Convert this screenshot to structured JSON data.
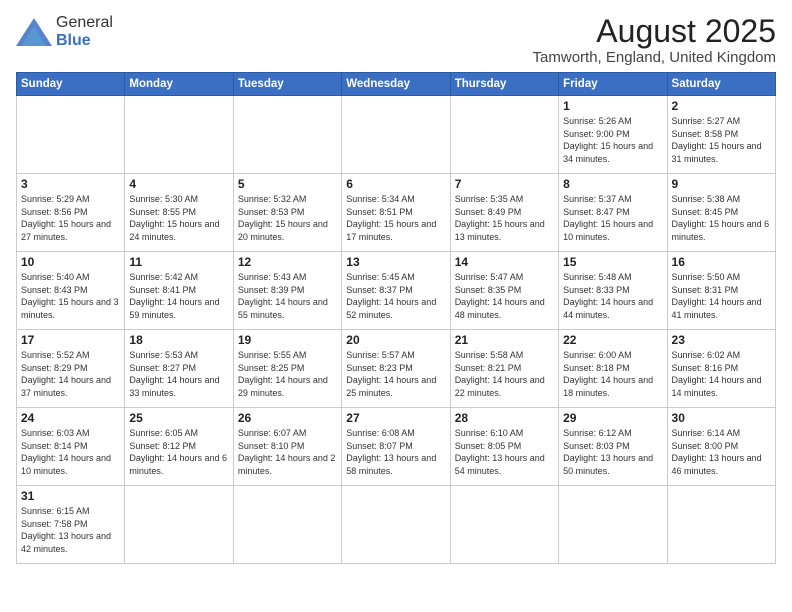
{
  "header": {
    "logo_general": "General",
    "logo_blue": "Blue",
    "title": "August 2025",
    "subtitle": "Tamworth, England, United Kingdom"
  },
  "days_of_week": [
    "Sunday",
    "Monday",
    "Tuesday",
    "Wednesday",
    "Thursday",
    "Friday",
    "Saturday"
  ],
  "weeks": [
    [
      {
        "day": "",
        "info": ""
      },
      {
        "day": "",
        "info": ""
      },
      {
        "day": "",
        "info": ""
      },
      {
        "day": "",
        "info": ""
      },
      {
        "day": "",
        "info": ""
      },
      {
        "day": "1",
        "info": "Sunrise: 5:26 AM\nSunset: 9:00 PM\nDaylight: 15 hours and 34 minutes."
      },
      {
        "day": "2",
        "info": "Sunrise: 5:27 AM\nSunset: 8:58 PM\nDaylight: 15 hours and 31 minutes."
      }
    ],
    [
      {
        "day": "3",
        "info": "Sunrise: 5:29 AM\nSunset: 8:56 PM\nDaylight: 15 hours and 27 minutes."
      },
      {
        "day": "4",
        "info": "Sunrise: 5:30 AM\nSunset: 8:55 PM\nDaylight: 15 hours and 24 minutes."
      },
      {
        "day": "5",
        "info": "Sunrise: 5:32 AM\nSunset: 8:53 PM\nDaylight: 15 hours and 20 minutes."
      },
      {
        "day": "6",
        "info": "Sunrise: 5:34 AM\nSunset: 8:51 PM\nDaylight: 15 hours and 17 minutes."
      },
      {
        "day": "7",
        "info": "Sunrise: 5:35 AM\nSunset: 8:49 PM\nDaylight: 15 hours and 13 minutes."
      },
      {
        "day": "8",
        "info": "Sunrise: 5:37 AM\nSunset: 8:47 PM\nDaylight: 15 hours and 10 minutes."
      },
      {
        "day": "9",
        "info": "Sunrise: 5:38 AM\nSunset: 8:45 PM\nDaylight: 15 hours and 6 minutes."
      }
    ],
    [
      {
        "day": "10",
        "info": "Sunrise: 5:40 AM\nSunset: 8:43 PM\nDaylight: 15 hours and 3 minutes."
      },
      {
        "day": "11",
        "info": "Sunrise: 5:42 AM\nSunset: 8:41 PM\nDaylight: 14 hours and 59 minutes."
      },
      {
        "day": "12",
        "info": "Sunrise: 5:43 AM\nSunset: 8:39 PM\nDaylight: 14 hours and 55 minutes."
      },
      {
        "day": "13",
        "info": "Sunrise: 5:45 AM\nSunset: 8:37 PM\nDaylight: 14 hours and 52 minutes."
      },
      {
        "day": "14",
        "info": "Sunrise: 5:47 AM\nSunset: 8:35 PM\nDaylight: 14 hours and 48 minutes."
      },
      {
        "day": "15",
        "info": "Sunrise: 5:48 AM\nSunset: 8:33 PM\nDaylight: 14 hours and 44 minutes."
      },
      {
        "day": "16",
        "info": "Sunrise: 5:50 AM\nSunset: 8:31 PM\nDaylight: 14 hours and 41 minutes."
      }
    ],
    [
      {
        "day": "17",
        "info": "Sunrise: 5:52 AM\nSunset: 8:29 PM\nDaylight: 14 hours and 37 minutes."
      },
      {
        "day": "18",
        "info": "Sunrise: 5:53 AM\nSunset: 8:27 PM\nDaylight: 14 hours and 33 minutes."
      },
      {
        "day": "19",
        "info": "Sunrise: 5:55 AM\nSunset: 8:25 PM\nDaylight: 14 hours and 29 minutes."
      },
      {
        "day": "20",
        "info": "Sunrise: 5:57 AM\nSunset: 8:23 PM\nDaylight: 14 hours and 25 minutes."
      },
      {
        "day": "21",
        "info": "Sunrise: 5:58 AM\nSunset: 8:21 PM\nDaylight: 14 hours and 22 minutes."
      },
      {
        "day": "22",
        "info": "Sunrise: 6:00 AM\nSunset: 8:18 PM\nDaylight: 14 hours and 18 minutes."
      },
      {
        "day": "23",
        "info": "Sunrise: 6:02 AM\nSunset: 8:16 PM\nDaylight: 14 hours and 14 minutes."
      }
    ],
    [
      {
        "day": "24",
        "info": "Sunrise: 6:03 AM\nSunset: 8:14 PM\nDaylight: 14 hours and 10 minutes."
      },
      {
        "day": "25",
        "info": "Sunrise: 6:05 AM\nSunset: 8:12 PM\nDaylight: 14 hours and 6 minutes."
      },
      {
        "day": "26",
        "info": "Sunrise: 6:07 AM\nSunset: 8:10 PM\nDaylight: 14 hours and 2 minutes."
      },
      {
        "day": "27",
        "info": "Sunrise: 6:08 AM\nSunset: 8:07 PM\nDaylight: 13 hours and 58 minutes."
      },
      {
        "day": "28",
        "info": "Sunrise: 6:10 AM\nSunset: 8:05 PM\nDaylight: 13 hours and 54 minutes."
      },
      {
        "day": "29",
        "info": "Sunrise: 6:12 AM\nSunset: 8:03 PM\nDaylight: 13 hours and 50 minutes."
      },
      {
        "day": "30",
        "info": "Sunrise: 6:14 AM\nSunset: 8:00 PM\nDaylight: 13 hours and 46 minutes."
      }
    ],
    [
      {
        "day": "31",
        "info": "Sunrise: 6:15 AM\nSunset: 7:58 PM\nDaylight: 13 hours and 42 minutes."
      },
      {
        "day": "",
        "info": ""
      },
      {
        "day": "",
        "info": ""
      },
      {
        "day": "",
        "info": ""
      },
      {
        "day": "",
        "info": ""
      },
      {
        "day": "",
        "info": ""
      },
      {
        "day": "",
        "info": ""
      }
    ]
  ]
}
